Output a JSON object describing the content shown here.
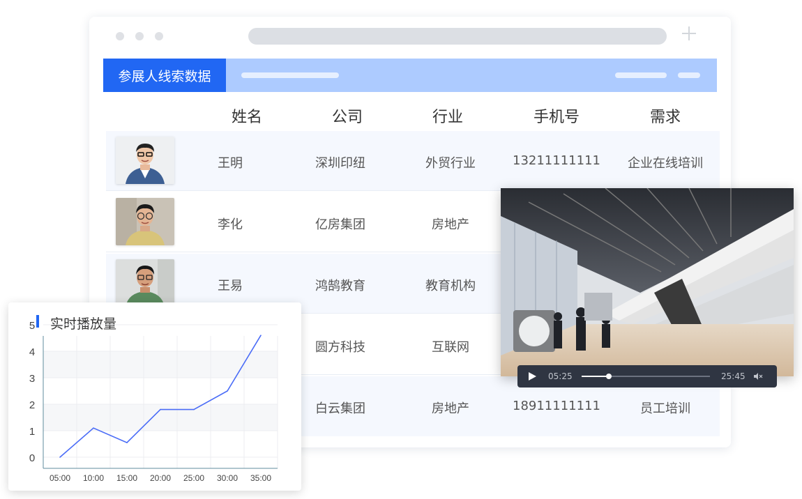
{
  "panel": {
    "title": "参展人线索数据",
    "columns": [
      "姓名",
      "公司",
      "行业",
      "手机号",
      "需求"
    ]
  },
  "rows": [
    {
      "name": "王明",
      "company": "深圳印纽",
      "industry": "外贸行业",
      "phone": "13211111111",
      "need": "企业在线培训"
    },
    {
      "name": "李化",
      "company": "亿房集团",
      "industry": "房地产",
      "phone": "",
      "need": ""
    },
    {
      "name": "王易",
      "company": "鸿鹄教育",
      "industry": "教育机构",
      "phone": "",
      "need": ""
    },
    {
      "name": "",
      "company": "圆方科技",
      "industry": "互联网",
      "phone": "",
      "need": ""
    },
    {
      "name": "",
      "company": "白云集团",
      "industry": "房地产",
      "phone": "18911111111",
      "need": "员工培训"
    }
  ],
  "player": {
    "current_time": "05:25",
    "duration": "25:45",
    "progress": 0.21
  },
  "chart_data": {
    "type": "line",
    "title": "实时播放量",
    "categories": [
      "05:00",
      "10:00",
      "15:00",
      "20:00",
      "25:00",
      "30:00",
      "35:00"
    ],
    "x": [
      0,
      1,
      2,
      3,
      4,
      5,
      6,
      7
    ],
    "values": [
      0,
      1.1,
      0.55,
      1.8,
      1.8,
      2.5,
      4.6
    ],
    "x_points": [
      0.5,
      1.5,
      2.5,
      3.5,
      4.5,
      5.5,
      6.5
    ],
    "ylim": [
      0,
      5
    ],
    "yticks": [
      "0",
      "1",
      "2",
      "3",
      "4",
      "5"
    ],
    "grid": true,
    "line_color": "#4a6cf7"
  },
  "colors": {
    "accent": "#2167f3",
    "header_bar": "#adcbff"
  }
}
